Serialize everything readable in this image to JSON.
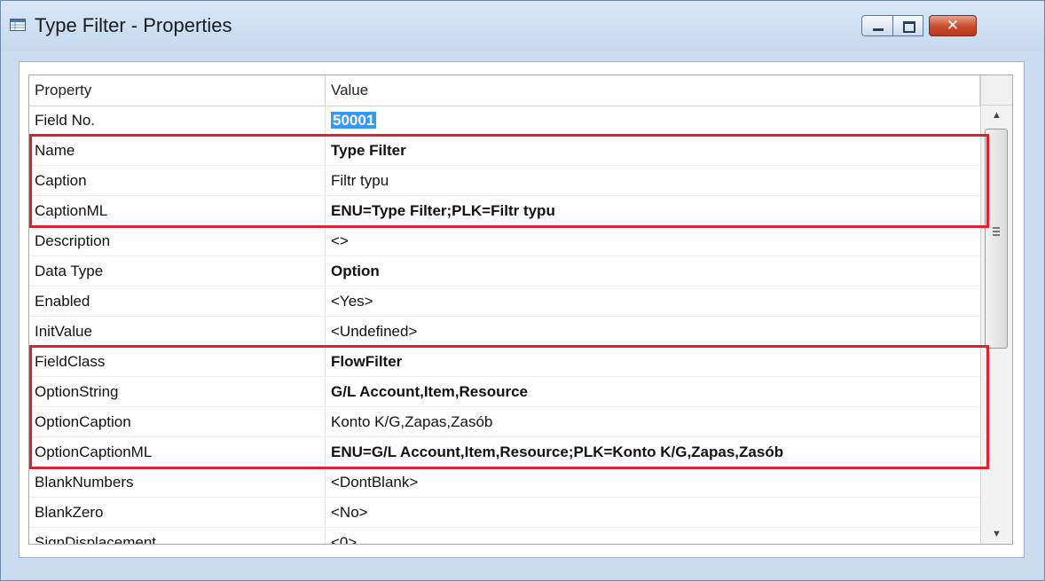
{
  "window": {
    "title": "Type Filter - Properties",
    "close_glyph": "✕"
  },
  "icons": [
    "properties-window-icon",
    "minimize-icon",
    "maximize-icon",
    "close-icon",
    "scroll-up-icon",
    "scroll-down-icon"
  ],
  "colors": {
    "highlight": "#e0202c",
    "selection": "#3399ff",
    "titlebar": "#c9dcf0"
  },
  "grid": {
    "headers": {
      "property": "Property",
      "value": "Value"
    },
    "rows": [
      {
        "property": "Field No.",
        "value": "50001"
      },
      {
        "property": "Name",
        "value": "Type Filter"
      },
      {
        "property": "Caption",
        "value": "Filtr typu"
      },
      {
        "property": "CaptionML",
        "value": "ENU=Type Filter;PLK=Filtr typu"
      },
      {
        "property": "Description",
        "value": "<>"
      },
      {
        "property": "Data Type",
        "value": "Option"
      },
      {
        "property": "Enabled",
        "value": "<Yes>"
      },
      {
        "property": "InitValue",
        "value": "<Undefined>"
      },
      {
        "property": "FieldClass",
        "value": "FlowFilter"
      },
      {
        "property": "OptionString",
        "value": "G/L Account,Item,Resource"
      },
      {
        "property": "OptionCaption",
        "value": "Konto K/G,Zapas,Zasób"
      },
      {
        "property": "OptionCaptionML",
        "value": "ENU=G/L Account,Item,Resource;PLK=Konto K/G,Zapas,Zasób"
      },
      {
        "property": "BlankNumbers",
        "value": "<DontBlank>"
      },
      {
        "property": "BlankZero",
        "value": "<No>"
      },
      {
        "property": "SignDisplacement",
        "value": "<0>"
      }
    ]
  },
  "scrollbar": {
    "up": "▲",
    "down": "▼"
  }
}
